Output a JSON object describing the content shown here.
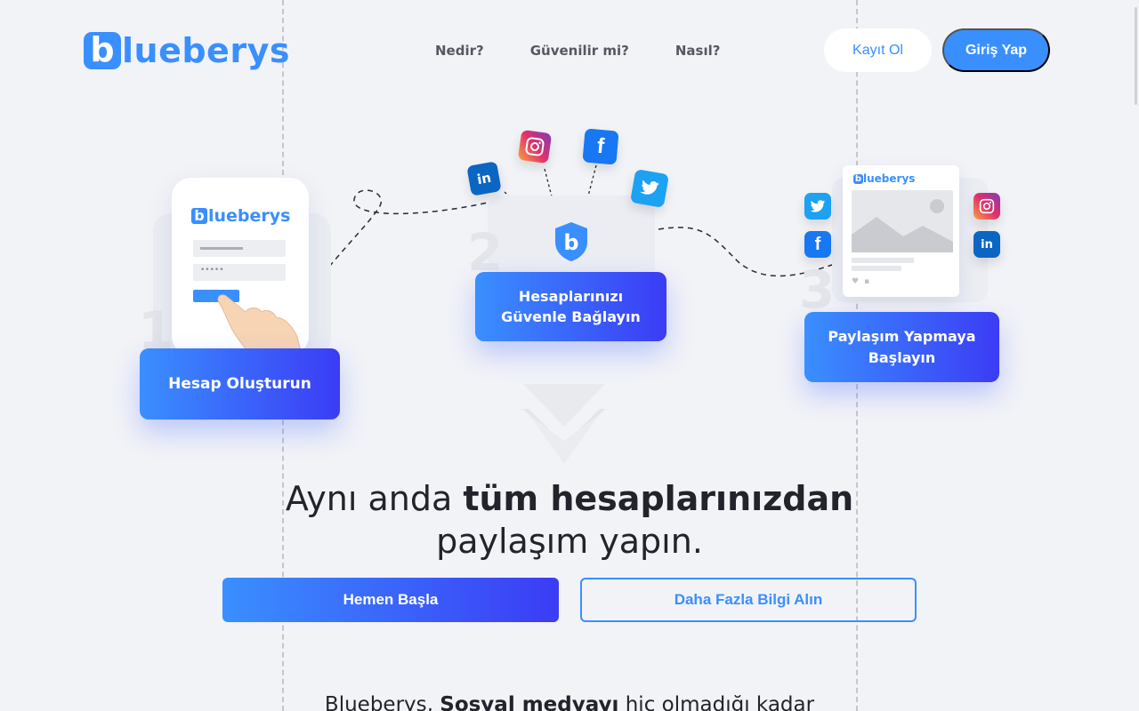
{
  "brand": {
    "logo_initial": "b",
    "logo_rest": "lueberys"
  },
  "nav": {
    "items": [
      "Nedir?",
      "Güvenilir mi?",
      "Nasıl?"
    ]
  },
  "auth": {
    "register_label": "Kayıt Ol",
    "login_label": "Giriş Yap"
  },
  "steps": {
    "step1": {
      "number": "1",
      "label": "Hesap Oluşturun",
      "masked_password": "•••••"
    },
    "step2": {
      "number": "2",
      "label_line1": "Hesaplarınızı",
      "label_line2": "Güvenle Bağlayın"
    },
    "step3": {
      "number": "3",
      "label_line1": "Paylaşım Yapmaya",
      "label_line2": "Başlayın"
    }
  },
  "social_icons": [
    "linkedin-icon",
    "instagram-icon",
    "facebook-icon",
    "twitter-icon"
  ],
  "hero": {
    "line1_normal": "Aynı anda ",
    "line1_bold": "tüm hesaplarınızdan",
    "line2": "paylaşım yapın."
  },
  "cta": {
    "start_label": "Hemen Başla",
    "more_label": "Daha Fazla Bilgi Alın"
  },
  "subtext": {
    "part1": "Blueberys, ",
    "bold": "Sosyal medyayı",
    "part2": " hiç olmadığı kadar"
  },
  "colors": {
    "accent": "#3a8fff",
    "gradient_end": "#3b3cf5",
    "background": "#f2f3f7"
  }
}
